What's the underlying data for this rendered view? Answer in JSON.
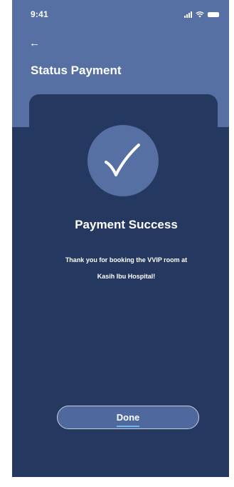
{
  "status_bar": {
    "time": "9:41",
    "icons": [
      "signal-icon",
      "wifi-icon",
      "battery-icon"
    ]
  },
  "header": {
    "back_icon": "←",
    "title": "Status Payment"
  },
  "success": {
    "icon": "checkmark-icon",
    "title": "Payment Success",
    "message_line1": "Thank you for booking the VVIP room at",
    "message_line2": "Kasih Ibu Hospital!"
  },
  "actions": {
    "done_label": "Done"
  },
  "colors": {
    "header_bg": "#5670a4",
    "body_bg": "#25385f",
    "accent_circle": "#5670a4",
    "text": "#ffffff"
  }
}
